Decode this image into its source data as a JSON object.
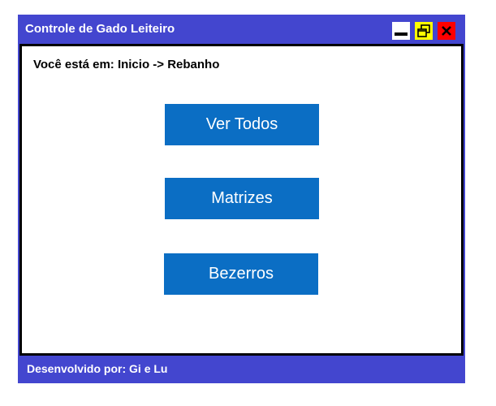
{
  "window": {
    "title": "Controle de Gado Leiteiro",
    "controls": {
      "minimize_icon": "minimize-icon",
      "maximize_icon": "restore-icon",
      "close_icon": "close-icon"
    }
  },
  "breadcrumb": {
    "text": "Você está em: Inicio -> Rebanho"
  },
  "menu": {
    "buttons": [
      {
        "label": "Ver Todos"
      },
      {
        "label": "Matrizes"
      },
      {
        "label": "Bezerros"
      }
    ]
  },
  "footer": {
    "text": "Desenvolvido por: Gi e Lu"
  },
  "colors": {
    "frame": "#4346cf",
    "button": "#0b6ec4",
    "minimize_bg": "#ffffff",
    "maximize_bg": "#ffff00",
    "close_bg": "#ff0000"
  }
}
